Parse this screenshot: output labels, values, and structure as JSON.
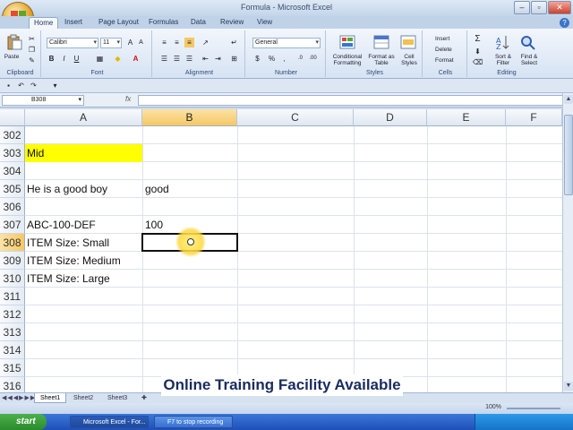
{
  "window": {
    "title": "Formula - Microsoft Excel"
  },
  "ribbon_tabs": [
    "Home",
    "Insert",
    "Page Layout",
    "Formulas",
    "Data",
    "Review",
    "View"
  ],
  "ribbon": {
    "font_name": "Calibri",
    "font_size": "11",
    "number_format": "General",
    "groups": [
      "Clipboard",
      "Font",
      "Alignment",
      "Number",
      "Styles",
      "Cells",
      "Editing"
    ],
    "paste_label": "Paste",
    "styles": [
      "Conditional Formatting",
      "Format as Table",
      "Cell Styles"
    ],
    "cells": [
      "Insert",
      "Delete",
      "Format"
    ],
    "editing": [
      "Sort & Filter",
      "Find & Select"
    ]
  },
  "formula_bar": {
    "name_box": "B308",
    "fx": "fx",
    "value": ""
  },
  "columns": [
    "A",
    "B",
    "C",
    "D",
    "E",
    "F"
  ],
  "selected_column": "B",
  "rows": [
    {
      "num": "302",
      "a": "",
      "b": ""
    },
    {
      "num": "303",
      "a": "Mid",
      "b": "",
      "a_fill": "yellow"
    },
    {
      "num": "304",
      "a": "",
      "b": ""
    },
    {
      "num": "305",
      "a": "He is a good boy",
      "b": "good"
    },
    {
      "num": "306",
      "a": "",
      "b": ""
    },
    {
      "num": "307",
      "a": "ABC-100-DEF",
      "b": "100"
    },
    {
      "num": "308",
      "a": "ITEM Size: Small",
      "b": "",
      "selected": true
    },
    {
      "num": "309",
      "a": "ITEM Size: Medium",
      "b": ""
    },
    {
      "num": "310",
      "a": "ITEM Size: Large",
      "b": ""
    },
    {
      "num": "311",
      "a": "",
      "b": ""
    },
    {
      "num": "312",
      "a": "",
      "b": ""
    },
    {
      "num": "313",
      "a": "",
      "b": ""
    },
    {
      "num": "314",
      "a": "",
      "b": ""
    },
    {
      "num": "315",
      "a": "",
      "b": ""
    },
    {
      "num": "316",
      "a": "",
      "b": ""
    }
  ],
  "sheets": [
    "Sheet1",
    "Sheet2",
    "Sheet3"
  ],
  "active_sheet": "Sheet1",
  "status": {
    "zoom": "100%"
  },
  "banner": "Online Training Facility Available",
  "taskbar": {
    "start": "start",
    "tasks": [
      "Microsoft Excel - For...",
      "F7 to stop recording"
    ],
    "clock": ""
  },
  "colors": {
    "selected_header": "#f5c764",
    "highlight": "#ffff00",
    "accent": "#1f4fb8"
  }
}
